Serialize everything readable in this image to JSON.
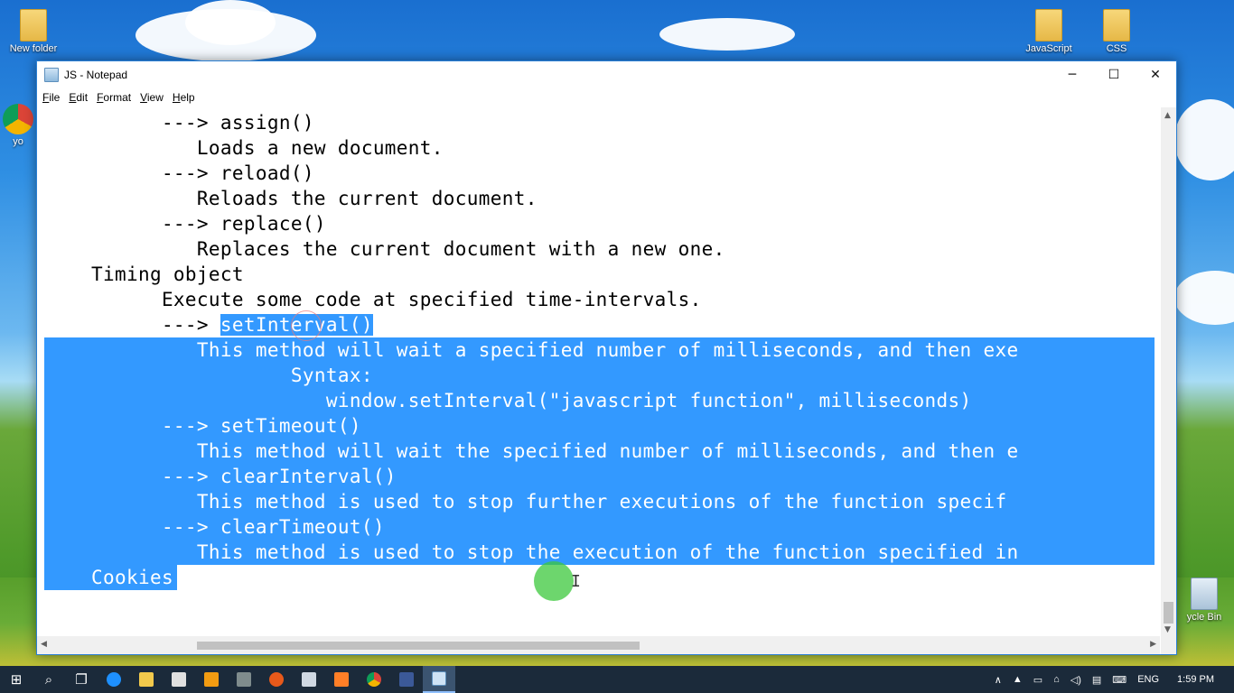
{
  "desktop": {
    "icons": [
      {
        "label": "New folder"
      },
      {
        "label": "JavaScript"
      },
      {
        "label": "CSS"
      },
      {
        "label": "ycle Bin"
      },
      {
        "label": "yo"
      }
    ]
  },
  "window": {
    "title": "JS - Notepad",
    "controls": {
      "minimize": "─",
      "maximize": "☐",
      "close": "✕"
    }
  },
  "menu": [
    {
      "accel": "F",
      "rest": "ile"
    },
    {
      "accel": "E",
      "rest": "dit"
    },
    {
      "accel": "F",
      "rest": "ormat"
    },
    {
      "accel": "V",
      "rest": "iew"
    },
    {
      "accel": "H",
      "rest": "elp"
    }
  ],
  "editor": {
    "lines": [
      {
        "indent": "          ",
        "text": "---> assign()"
      },
      {
        "indent": "             ",
        "text": "Loads a new document."
      },
      {
        "indent": "          ",
        "text": "---> reload()"
      },
      {
        "indent": "             ",
        "text": "Reloads the current document."
      },
      {
        "indent": "          ",
        "text": "---> replace()"
      },
      {
        "indent": "             ",
        "text": "Replaces the current document with a new one."
      },
      {
        "indent": "    ",
        "text": "Timing object"
      },
      {
        "indent": "          ",
        "text": "Execute some code at specified time-intervals."
      },
      {
        "indent": "          ",
        "prefix": "---> ",
        "selected": "setInterval()"
      },
      {
        "indent": "             ",
        "selected": "This method will wait a specified number of milliseconds, and then exe"
      },
      {
        "indent": "                     ",
        "selected": "Syntax:"
      },
      {
        "indent": "                        ",
        "selected": "window.setInterval(\"javascript function\", milliseconds)"
      },
      {
        "indent": "          ",
        "selected": "---> setTimeout()"
      },
      {
        "indent": "             ",
        "selected": "This method will wait the specified number of milliseconds, and then e"
      },
      {
        "indent": "          ",
        "selected": "---> clearInterval()"
      },
      {
        "indent": "             ",
        "selected": "This method is used to stop further executions of the function specif"
      },
      {
        "indent": "          ",
        "selected": "---> clearTimeout()"
      },
      {
        "indent": "             ",
        "selected": "This method is used to stop the execution of the function specified in"
      },
      {
        "indent": "    ",
        "selected": "Cookies"
      }
    ]
  },
  "taskbar": {
    "language": "ENG",
    "time": "1:59 PM"
  },
  "colors": {
    "selection": "#3399ff",
    "taskbar": "#1b2a3a",
    "window_border": "#2a7fd4"
  }
}
